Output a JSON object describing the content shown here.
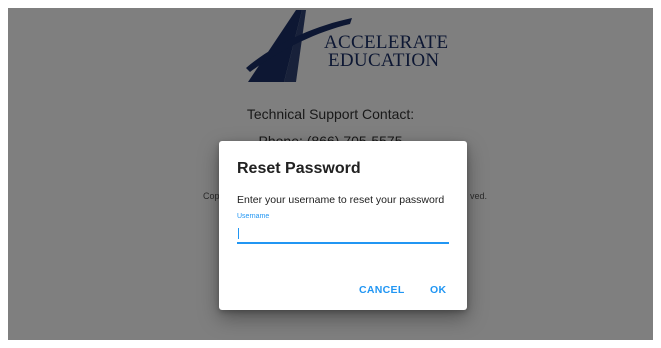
{
  "background": {
    "logo": {
      "line1": "ACCELERATE",
      "line2": "EDUCATION"
    },
    "support_title": "Technical Support Contact:",
    "support_phone": "Phone: (866) 705-5575",
    "copyright_left": "Cop",
    "copyright_right": "ved."
  },
  "dialog": {
    "title": "Reset Password",
    "description": "Enter your username to reset your password",
    "username_label": "Username",
    "username_value": "",
    "cancel_label": "CANCEL",
    "ok_label": "OK"
  },
  "colors": {
    "accent": "#2196f3",
    "logo_navy": "#1a2f66",
    "scrim": "rgba(0,0,0,0.5)"
  }
}
